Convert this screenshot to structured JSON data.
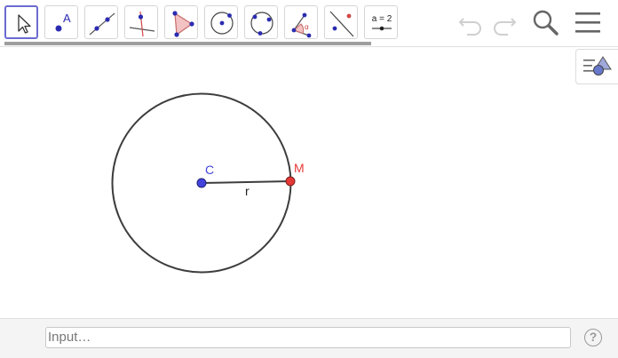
{
  "toolbar": {
    "tools": [
      {
        "name": "move-tool",
        "label": ""
      },
      {
        "name": "point-tool",
        "label": "A"
      },
      {
        "name": "line-tool",
        "label": ""
      },
      {
        "name": "perpendicular-line-tool",
        "label": ""
      },
      {
        "name": "polygon-tool",
        "label": ""
      },
      {
        "name": "circle-center-point-tool",
        "label": ""
      },
      {
        "name": "circle-three-points-tool",
        "label": ""
      },
      {
        "name": "angle-tool",
        "label": "α"
      },
      {
        "name": "reflect-tool",
        "label": ""
      },
      {
        "name": "slider-tool",
        "label": "a = 2"
      }
    ],
    "selected": "move-tool",
    "right_icons": [
      "undo-icon",
      "redo-icon",
      "search-icon",
      "menu-icon"
    ]
  },
  "graphics": {
    "center_label": "C",
    "point_label": "M",
    "segment_label": "r",
    "colors": {
      "center_point": "#4444dd",
      "circle_point": "#e53935",
      "circle_stroke": "#3d3d3d"
    }
  },
  "input_bar": {
    "placeholder": "Input…",
    "help_symbol": "?"
  }
}
